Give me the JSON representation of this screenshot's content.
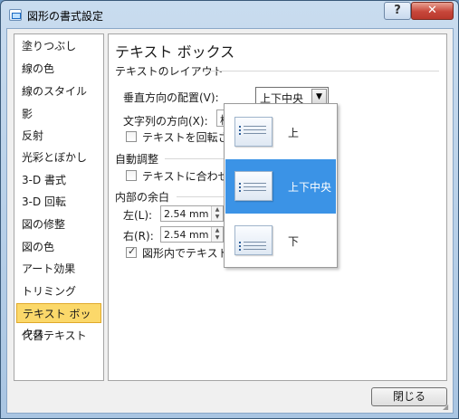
{
  "window": {
    "title": "図形の書式設定",
    "help": "?",
    "close": "✕"
  },
  "sidebar": {
    "items": [
      {
        "label": "塗りつぶし"
      },
      {
        "label": "線の色"
      },
      {
        "label": "線のスタイル"
      },
      {
        "label": "影"
      },
      {
        "label": "反射"
      },
      {
        "label": "光彩とぼかし"
      },
      {
        "label": "3-D 書式"
      },
      {
        "label": "3-D 回転"
      },
      {
        "label": "図の修整"
      },
      {
        "label": "図の色"
      },
      {
        "label": "アート効果"
      },
      {
        "label": "トリミング"
      },
      {
        "label": "テキスト ボックス"
      },
      {
        "label": "代替テキスト"
      }
    ],
    "active_index": 12
  },
  "panel": {
    "title": "テキスト ボックス",
    "layout_group": "テキストのレイアウト",
    "vertical_align_label": "垂直方向の配置(V):",
    "vertical_align_value": "上下中央",
    "text_direction_label": "文字列の方向(X):",
    "text_direction_value_partial": "横",
    "no_rotate_label_partial": "テキストを回転させな",
    "autofit_group": "自動調整",
    "resize_label_partial": "テキストに合わせて図",
    "margin_group": "内部の余白",
    "left_label": "左(L):",
    "left_value": "2.54 mm",
    "right_label": "右(R):",
    "right_value": "2.54 mm",
    "wrap_label_partial": "図形内でテキストを"
  },
  "dropdown": {
    "options": [
      {
        "label": "上",
        "icon": "align-top-icon"
      },
      {
        "label": "上下中央",
        "icon": "align-middle-icon"
      },
      {
        "label": "下",
        "icon": "align-bottom-icon"
      }
    ],
    "selected_index": 1,
    "selected_color": "#3b93e6"
  },
  "footer": {
    "close_label": "閉じる"
  }
}
